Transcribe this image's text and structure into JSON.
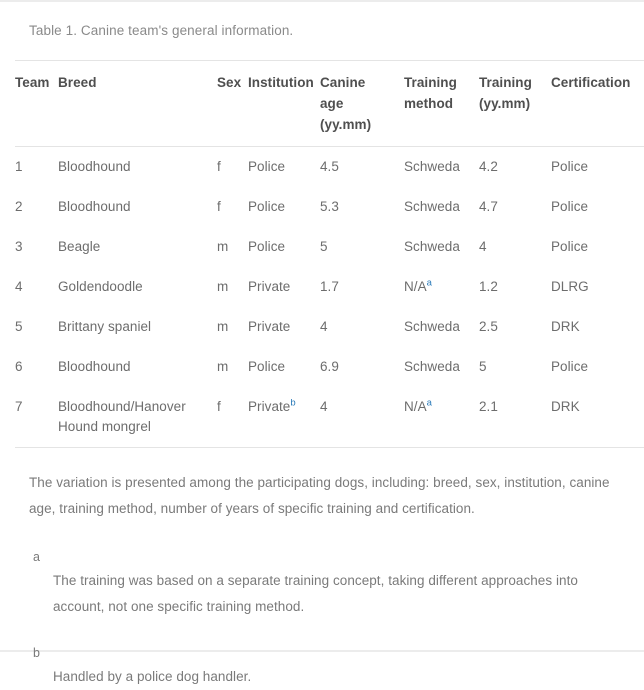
{
  "caption": "Table 1. Canine team's general information.",
  "accent_link_color": "#2b7bb9",
  "table": {
    "columns": [
      {
        "key": "team",
        "label": "Team"
      },
      {
        "key": "breed",
        "label": "Breed"
      },
      {
        "key": "sex",
        "label": "Sex"
      },
      {
        "key": "inst",
        "label": "Institution"
      },
      {
        "key": "age",
        "label": "Canine age (yy.mm)"
      },
      {
        "key": "method",
        "label": "Training method"
      },
      {
        "key": "tyrs",
        "label": "Training (yy.mm)"
      },
      {
        "key": "cert",
        "label": "Certification"
      }
    ],
    "header_lines": {
      "team": [
        "Team"
      ],
      "breed": [
        "Breed"
      ],
      "sex": [
        "Sex"
      ],
      "inst": [
        "Institution"
      ],
      "age": [
        "Canine",
        "age",
        "(yy.mm)"
      ],
      "method": [
        "Training",
        "method"
      ],
      "tyrs": [
        "Training",
        "(yy.mm)"
      ],
      "cert": [
        "Certification"
      ]
    },
    "rows": [
      {
        "team": "1",
        "breed": "Bloodhound",
        "sex": "f",
        "inst": "Police",
        "inst_fn": "",
        "age": "4.5",
        "method": "Schweda",
        "method_fn": "",
        "tyrs": "4.2",
        "cert": "Police"
      },
      {
        "team": "2",
        "breed": "Bloodhound",
        "sex": "f",
        "inst": "Police",
        "inst_fn": "",
        "age": "5.3",
        "method": "Schweda",
        "method_fn": "",
        "tyrs": "4.7",
        "cert": "Police"
      },
      {
        "team": "3",
        "breed": "Beagle",
        "sex": "m",
        "inst": "Police",
        "inst_fn": "",
        "age": "5",
        "method": "Schweda",
        "method_fn": "",
        "tyrs": "4",
        "cert": "Police"
      },
      {
        "team": "4",
        "breed": "Goldendoodle",
        "sex": "m",
        "inst": "Private",
        "inst_fn": "",
        "age": "1.7",
        "method": "N/A",
        "method_fn": "a",
        "tyrs": "1.2",
        "cert": "DLRG"
      },
      {
        "team": "5",
        "breed": "Brittany spaniel",
        "sex": "m",
        "inst": "Private",
        "inst_fn": "",
        "age": "4",
        "method": "Schweda",
        "method_fn": "",
        "tyrs": "2.5",
        "cert": "DRK"
      },
      {
        "team": "6",
        "breed": "Bloodhound",
        "sex": "m",
        "inst": "Police",
        "inst_fn": "",
        "age": "6.9",
        "method": "Schweda",
        "method_fn": "",
        "tyrs": "5",
        "cert": "Police"
      },
      {
        "team": "7",
        "breed": "Bloodhound/Hanover Hound mongrel",
        "sex": "f",
        "inst": "Private",
        "inst_fn": "b",
        "age": "4",
        "method": "N/A",
        "method_fn": "a",
        "tyrs": "2.1",
        "cert": "DRK"
      }
    ]
  },
  "footer": {
    "description": "The variation is presented among the participating dogs, including: breed, sex, institution, canine age, training method, number of years of specific training and certification.",
    "footnotes": [
      {
        "label": "a",
        "text": "The training was based on a separate training concept, taking different approaches into account, not one specific training method."
      },
      {
        "label": "b",
        "text": "Handled by a police dog handler."
      }
    ]
  }
}
